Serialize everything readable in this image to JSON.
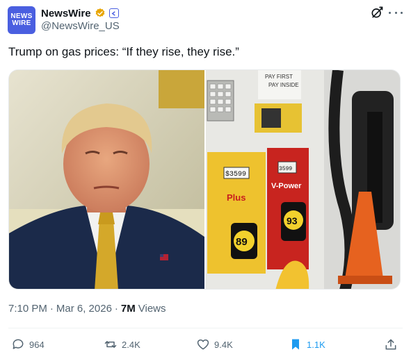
{
  "account": {
    "avatar_text_line1": "NEWS",
    "avatar_text_line2": "WIRE",
    "display_name": "NewsWire",
    "handle": "@NewsWire_US",
    "verified_badge_color": "#e8a500",
    "affiliate_badge_color": "#4a5fe0"
  },
  "tweet": {
    "text": "Trump on gas prices: “If they rise, they rise.”"
  },
  "media": {
    "pump": {
      "price_left": "$3599",
      "grade_left": "Plus",
      "octane_left": "89",
      "price_right": "3599",
      "grade_right": "V-Power",
      "octane_right": "93",
      "sign_text_1": "PAY FIRST",
      "sign_text_2": "PAY INSIDE"
    }
  },
  "meta": {
    "time": "7:10 PM",
    "separator": "·",
    "date": "Mar 6, 2026",
    "views_count": "7M",
    "views_label": "Views"
  },
  "actions": {
    "replies": "964",
    "reposts": "2.4K",
    "likes": "9.4K",
    "bookmarks": "1.1K"
  },
  "colors": {
    "accent": "#1d9bf0",
    "secondary_text": "#536471"
  }
}
